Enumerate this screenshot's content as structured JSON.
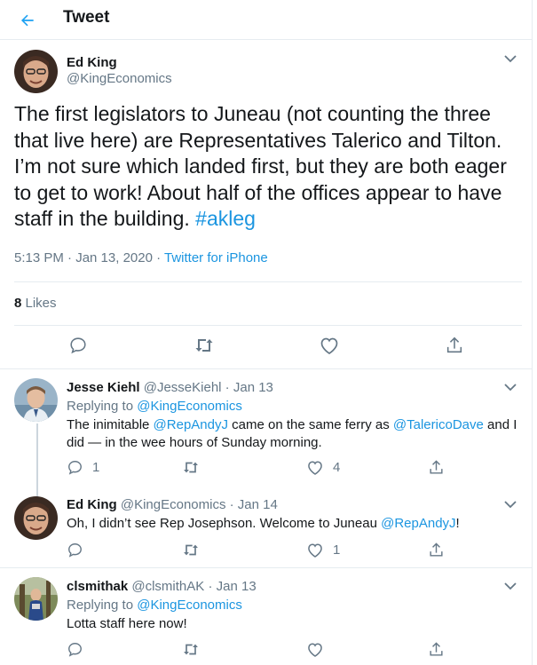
{
  "header": {
    "title": "Tweet"
  },
  "tweet": {
    "author_name": "Ed King",
    "author_handle": "@KingEconomics",
    "text_before": "The first legislators to Juneau (not counting the three that live here) are  Representatives Talerico and Tilton. I’m not sure which landed first, but they are both eager to get to work! About half of the offices appear to have staff in the building. ",
    "hashtag": "#akleg",
    "timestamp": "5:13 PM · Jan 13, 2020 · ",
    "source": "Twitter for iPhone",
    "likes_count": "8",
    "likes_label": " Likes"
  },
  "replies": [
    {
      "name": "Jesse Kiehl",
      "handle": "@JesseKiehl",
      "date": " · Jan 13",
      "replying_prefix": "Replying to ",
      "replying_to": "@KingEconomics",
      "text_1": "The inimitable ",
      "mention_1": "@RepAndyJ",
      "text_2": " came on the same ferry as ",
      "mention_2": "@TalericoDave",
      "text_3": " and I did — in the wee hours of Sunday morning.",
      "reply_count": "1",
      "like_count": "4"
    },
    {
      "name": "Ed King",
      "handle": "@KingEconomics",
      "date": " · Jan 14",
      "text_1": "Oh, I didn’t see Rep Josephson. Welcome to Juneau ",
      "mention_1": "@RepAndyJ",
      "text_2": "!",
      "like_count": "1"
    },
    {
      "name": "clsmithak",
      "handle": "@clsmithAK",
      "date": " · Jan 13",
      "replying_prefix": "Replying to ",
      "replying_to": "@KingEconomics",
      "text_1": "Lotta staff here now!"
    }
  ],
  "colors": {
    "accent": "#1b95e0",
    "muted": "#657786",
    "border": "#e6ecf0"
  },
  "icons": [
    "back-arrow-icon",
    "chevron-down-icon",
    "reply-icon",
    "retweet-icon",
    "like-icon",
    "share-icon"
  ]
}
